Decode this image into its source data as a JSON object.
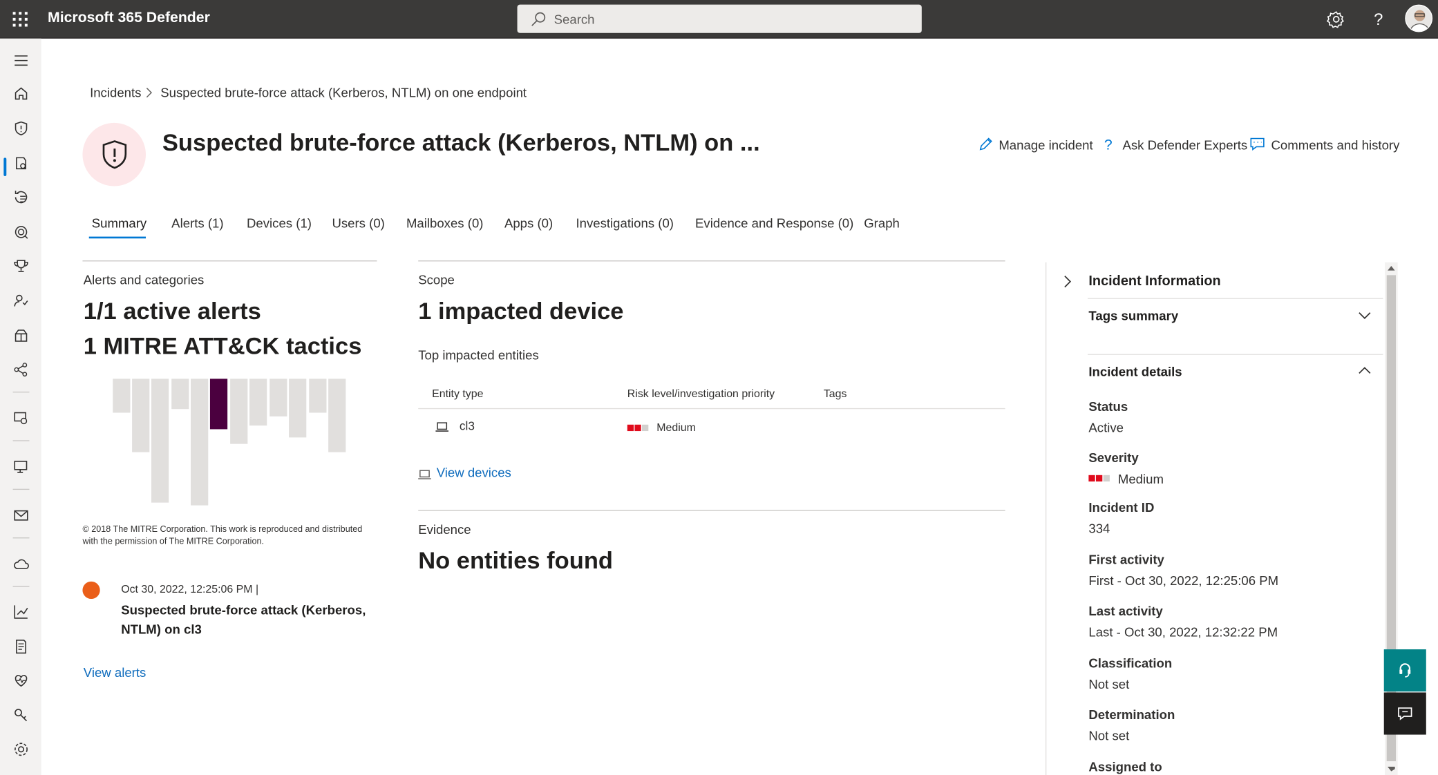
{
  "app": {
    "title": "Microsoft 365 Defender"
  },
  "search": {
    "placeholder": "Search"
  },
  "breadcrumb": {
    "root": "Incidents",
    "current": "Suspected brute-force attack (Kerberos, NTLM) on one endpoint"
  },
  "incident": {
    "title": "Suspected brute-force attack (Kerberos, NTLM) on ...",
    "actions": {
      "manage": "Manage incident",
      "ask": "Ask Defender Experts",
      "comments": "Comments and history"
    }
  },
  "tabs": [
    {
      "label": "Summary"
    },
    {
      "label": "Alerts (1)"
    },
    {
      "label": "Devices (1)"
    },
    {
      "label": "Users (0)"
    },
    {
      "label": "Mailboxes (0)"
    },
    {
      "label": "Apps (0)"
    },
    {
      "label": "Investigations (0)"
    },
    {
      "label": "Evidence and Response (0)"
    },
    {
      "label": "Graph"
    }
  ],
  "alerts_section": {
    "label": "Alerts and categories",
    "active_alerts": "1/1 active alerts",
    "tactics": "1 MITRE ATT&CK tactics",
    "copyright": "© 2018 The MITRE Corporation. This work is reproduced and distributed with the permission of The MITRE Corporation.",
    "alert": {
      "time": "Oct 30, 2022, 12:25:06 PM |",
      "title": "Suspected brute-force attack (Kerberos, NTLM) on cl3"
    },
    "view_alerts": "View alerts"
  },
  "scope": {
    "label": "Scope",
    "headline": "1 impacted device",
    "top_entities": "Top impacted entities",
    "columns": [
      "Entity type",
      "Risk level/investigation priority",
      "Tags"
    ],
    "row": {
      "entity": "cl3",
      "risk": "Medium"
    },
    "view_devices": "View devices"
  },
  "evidence": {
    "label": "Evidence",
    "headline": "No entities found"
  },
  "panel": {
    "title": "Incident Information",
    "tags_summary": "Tags summary",
    "incident_details": "Incident details",
    "fields": [
      {
        "label": "Status",
        "value": "Active"
      },
      {
        "label": "Severity",
        "value": "Medium"
      },
      {
        "label": "Incident ID",
        "value": "334"
      },
      {
        "label": "First activity",
        "value": "First - Oct 30, 2022, 12:25:06 PM"
      },
      {
        "label": "Last activity",
        "value": "Last - Oct 30, 2022, 12:32:22 PM"
      },
      {
        "label": "Classification",
        "value": "Not set"
      },
      {
        "label": "Determination",
        "value": "Not set"
      },
      {
        "label": "Assigned to",
        "value": ""
      }
    ]
  },
  "colors": {
    "accent": "#0078d4",
    "severity": "#e00b1c",
    "tactic_active": "#4b003f",
    "alert_dot": "#ea5e19",
    "float_teal": "#038387"
  }
}
